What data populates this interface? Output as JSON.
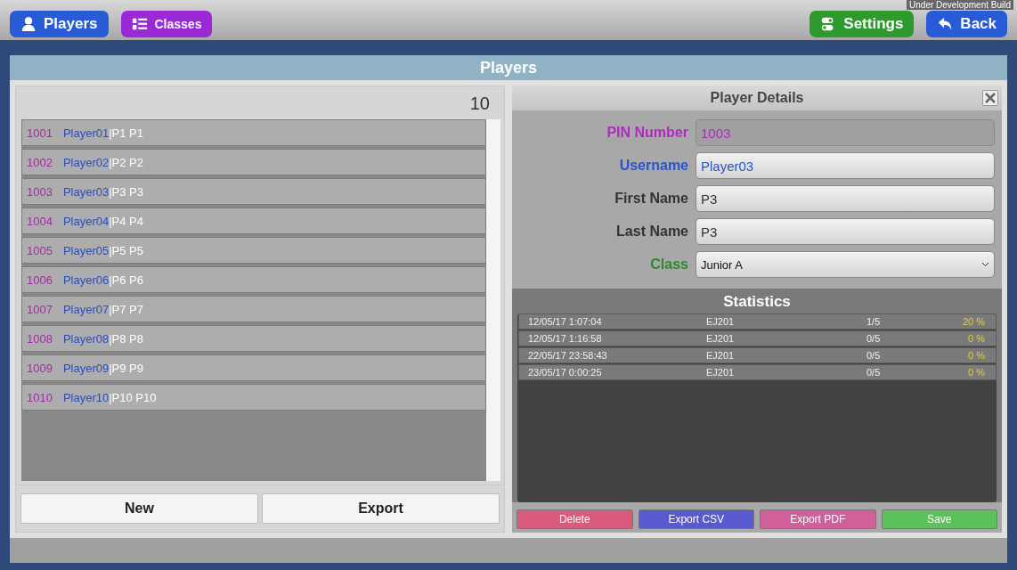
{
  "top_bar": {
    "left_buttons": [
      {
        "label": "Players",
        "color": "#2a5bd6"
      },
      {
        "label": "Classes",
        "color": "#9a2ad6"
      }
    ],
    "right_buttons": [
      {
        "label": "Settings",
        "color": "#2e9a2e"
      },
      {
        "label": "Back",
        "color": "#2a5bd6"
      }
    ],
    "build_note": "Under Development Build"
  },
  "panel_title": "Players",
  "player_list": {
    "count": "10",
    "rows": [
      {
        "pin": "1001",
        "username": "Player01",
        "name": "|P1 P1"
      },
      {
        "pin": "1002",
        "username": "Player02",
        "name": "|P2 P2"
      },
      {
        "pin": "1003",
        "username": "Player03",
        "name": "|P3 P3"
      },
      {
        "pin": "1004",
        "username": "Player04",
        "name": "|P4 P4"
      },
      {
        "pin": "1005",
        "username": "Player05",
        "name": "|P5 P5"
      },
      {
        "pin": "1006",
        "username": "Player06",
        "name": "|P6 P6"
      },
      {
        "pin": "1007",
        "username": "Player07",
        "name": "|P7 P7"
      },
      {
        "pin": "1008",
        "username": "Player08",
        "name": "|P8 P8"
      },
      {
        "pin": "1009",
        "username": "Player09",
        "name": "|P9 P9"
      },
      {
        "pin": "1010",
        "username": "Player10",
        "name": "|P10 P10"
      }
    ],
    "buttons": [
      "New",
      "Export"
    ]
  },
  "details": {
    "title": "Player Details",
    "fields": [
      {
        "label": "PIN Number",
        "value": "1003",
        "color": "#b02ac0",
        "kind": "text",
        "disabled": true
      },
      {
        "label": "Username",
        "value": "Player03",
        "color": "#2a55c8",
        "kind": "text",
        "disabled": false
      },
      {
        "label": "First Name",
        "value": "P3",
        "color": "#333333",
        "kind": "text",
        "disabled": false
      },
      {
        "label": "Last Name",
        "value": "P3",
        "color": "#333333",
        "kind": "text",
        "disabled": false
      },
      {
        "label": "Class",
        "value": "Junior A",
        "color": "#2e8a2e",
        "kind": "select",
        "disabled": false
      }
    ],
    "statistics": {
      "title": "Statistics",
      "rows": [
        {
          "date": "12/05/17 1:07:04",
          "code": "EJ201",
          "score": "1/5",
          "percent": "20 %"
        },
        {
          "date": "12/05/17 1:16:58",
          "code": "EJ201",
          "score": "0/5",
          "percent": "0 %"
        },
        {
          "date": "22/05/17 23:58:43",
          "code": "EJ201",
          "score": "0/5",
          "percent": "0 %"
        },
        {
          "date": "23/05/17 0:00:25",
          "code": "EJ201",
          "score": "0/5",
          "percent": "0 %"
        }
      ]
    },
    "buttons": [
      {
        "label": "Delete",
        "color": "#d95a7a"
      },
      {
        "label": "Export CSV",
        "color": "#5a5ad0"
      },
      {
        "label": "Export PDF",
        "color": "#d0609a"
      },
      {
        "label": "Save",
        "color": "#5cc05c"
      }
    ]
  }
}
